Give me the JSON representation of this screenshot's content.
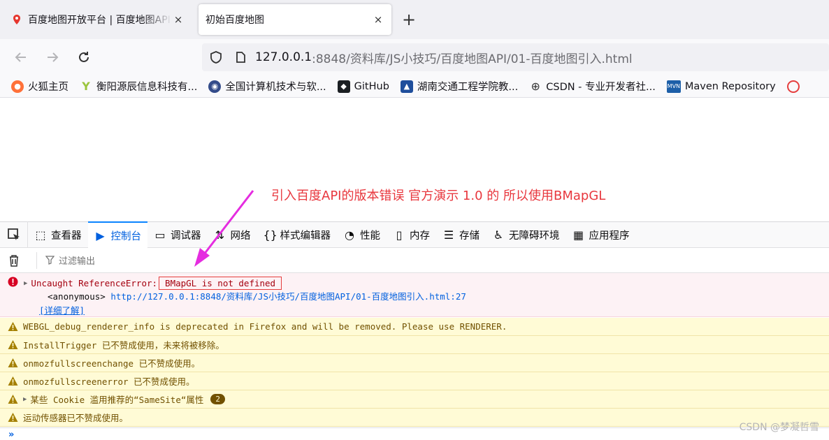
{
  "browser": {
    "tabs": [
      {
        "title": "百度地图开放平台 | 百度地图API SDK",
        "active": false,
        "favicon": "map-pin-icon"
      },
      {
        "title": "初始百度地图",
        "active": true
      }
    ],
    "new_tab_glyph": "+",
    "close_glyph": "×",
    "url_host": "127.0.0.1",
    "url_path": ":8848/资料库/JS小技巧/百度地图API/01-百度地图引入.html",
    "bookmarks": [
      {
        "label": "火狐主页",
        "icon": "firefox-icon",
        "color": "#ff7139"
      },
      {
        "label": "衡阳源辰信息科技有...",
        "icon": "y-logo-icon",
        "color": "#9bc53d"
      },
      {
        "label": "全国计算机技术与软...",
        "icon": "seal-icon",
        "color": "#334b8a"
      },
      {
        "label": "GitHub",
        "icon": "github-icon",
        "color": "#1b1f23"
      },
      {
        "label": "湖南交通工程学院教...",
        "icon": "school-icon",
        "color": "#1f4e9c"
      },
      {
        "label": "CSDN - 专业开发者社...",
        "icon": "globe-icon",
        "color": "#333333"
      },
      {
        "label": "Maven Repository",
        "icon": "maven-icon",
        "color": "#1d5fa8"
      }
    ]
  },
  "annotation": {
    "text": "引入百度API的版本错误  官方演示 1.0 的  所以使用BMapGL",
    "color": "#e8373e",
    "arrow_color": "#e52ce0"
  },
  "devtools": {
    "tabs": [
      {
        "label": "查看器",
        "icon": "inspector-icon",
        "glyph": "⬚"
      },
      {
        "label": "控制台",
        "icon": "console-icon",
        "glyph": "▶",
        "selected": true
      },
      {
        "label": "调试器",
        "icon": "debugger-icon",
        "glyph": "▭"
      },
      {
        "label": "网络",
        "icon": "network-icon",
        "glyph": "⇅"
      },
      {
        "label": "样式编辑器",
        "icon": "style-editor-icon",
        "glyph": "{}"
      },
      {
        "label": "性能",
        "icon": "performance-icon",
        "glyph": "◔"
      },
      {
        "label": "内存",
        "icon": "memory-icon",
        "glyph": "▯"
      },
      {
        "label": "存储",
        "icon": "storage-icon",
        "glyph": "☰"
      },
      {
        "label": "无障碍环境",
        "icon": "accessibility-icon",
        "glyph": "♿"
      },
      {
        "label": "应用程序",
        "icon": "application-icon",
        "glyph": "▦"
      }
    ],
    "filter_placeholder": "过滤输出",
    "error": {
      "prefix": "Uncaught ReferenceError: ",
      "message": "BMapGL is not defined",
      "location_label": "<anonymous>",
      "location_link": "http://127.0.0.1:8848/资料库/JS小技巧/百度地图API/01-百度地图引入.html:27",
      "learn_more": "[详细了解]"
    },
    "warnings": [
      {
        "text": "WEBGL_debug_renderer_info is deprecated in Firefox and will be removed. Please use RENDERER.",
        "expandable": false
      },
      {
        "text": "InstallTrigger 已不赞成使用，未来将被移除。",
        "expandable": false
      },
      {
        "text": "onmozfullscreenchange 已不赞成使用。",
        "expandable": false
      },
      {
        "text": "onmozfullscreenerror 已不赞成使用。",
        "expandable": false
      },
      {
        "text": "某些 Cookie 滥用推荐的“SameSite“属性",
        "expandable": true,
        "count": "2"
      },
      {
        "text": "运动传感器已不赞成使用。",
        "expandable": false
      }
    ],
    "prompt": "»"
  },
  "watermark": "CSDN @梦凝哲雪"
}
